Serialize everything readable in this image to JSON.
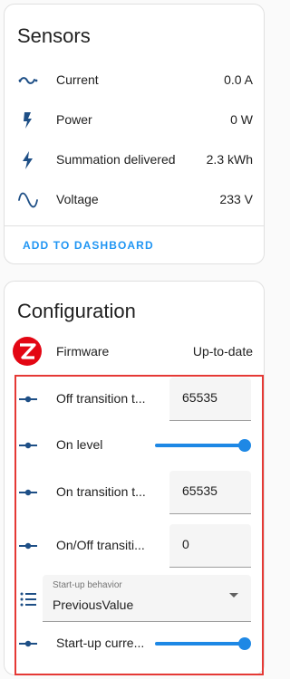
{
  "sensors": {
    "title": "Sensors",
    "items": [
      {
        "icon": "current-ac-icon",
        "label": "Current",
        "value": "0.0 A"
      },
      {
        "icon": "flash-icon",
        "label": "Power",
        "value": "0 W"
      },
      {
        "icon": "lightning-bolt-icon",
        "label": "Summation delivered",
        "value": "2.3 kWh"
      },
      {
        "icon": "sine-wave-icon",
        "label": "Voltage",
        "value": "233 V"
      }
    ],
    "action_label": "ADD TO DASHBOARD"
  },
  "configuration": {
    "title": "Configuration",
    "firmware": {
      "label": "Firmware",
      "value": "Up-to-date"
    },
    "rows": [
      {
        "label": "Off transition t...",
        "value": "65535"
      },
      {
        "label": "On level",
        "slider_fraction": 1.0
      },
      {
        "label": "On transition t...",
        "value": "65535"
      },
      {
        "label": "On/Off transiti...",
        "value": "0"
      },
      {
        "label": "",
        "select_label": "Start-up behavior",
        "select_value": "PreviousValue"
      },
      {
        "label": "Start-up curre...",
        "slider_fraction": 1.0
      }
    ]
  },
  "colors": {
    "accent": "#2196f3",
    "icon": "#1e4f86",
    "highlight_border": "#e53935",
    "zigbee_red": "#e30613"
  }
}
